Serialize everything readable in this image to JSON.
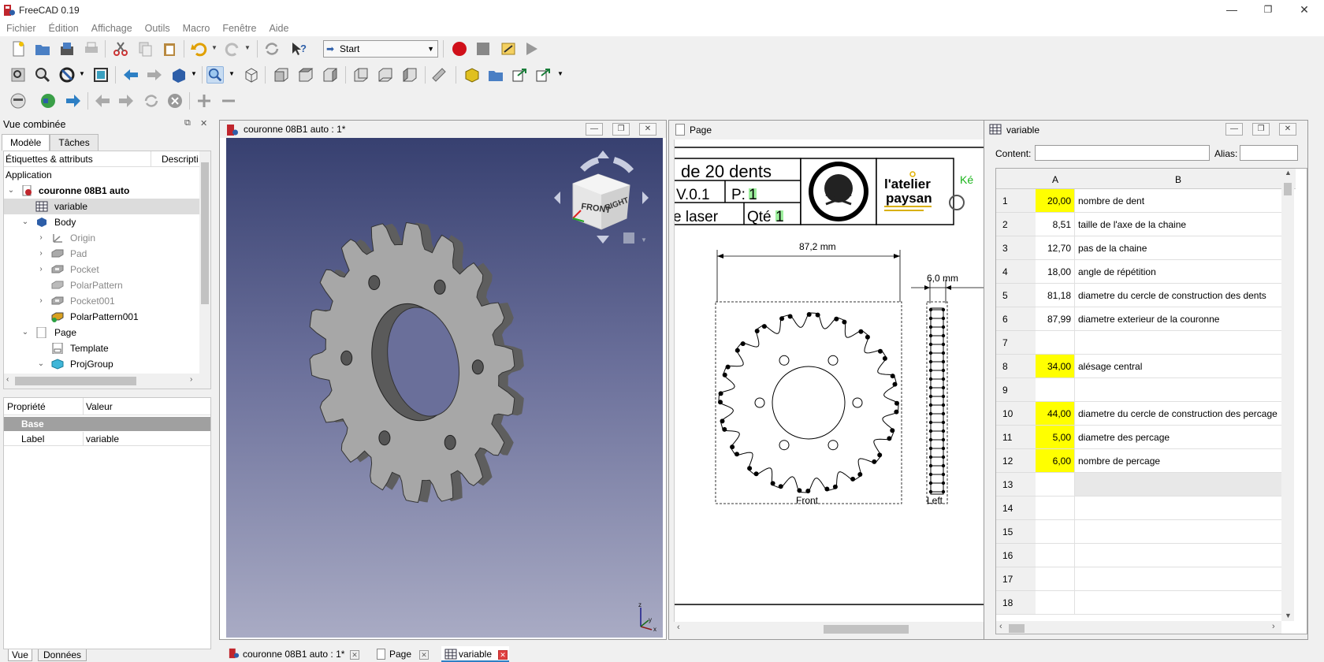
{
  "window": {
    "title": "FreeCAD 0.19",
    "min": "—",
    "max": "❐",
    "close": "✕"
  },
  "menu": [
    "Fichier",
    "Édition",
    "Affichage",
    "Outils",
    "Macro",
    "Fenêtre",
    "Aide"
  ],
  "toolbar": {
    "workbench": "Start"
  },
  "combo": {
    "title": "Vue combinée",
    "tabs": [
      "Modèle",
      "Tâches"
    ],
    "tree_headers": [
      "Étiquettes & attributs",
      "Descripti"
    ],
    "tree": [
      {
        "label": "Application"
      },
      {
        "label": "couronne 08B1 auto"
      },
      {
        "label": "variable"
      },
      {
        "label": "Body"
      },
      {
        "label": "Origin"
      },
      {
        "label": "Pad"
      },
      {
        "label": "Pocket"
      },
      {
        "label": "PolarPattern"
      },
      {
        "label": "Pocket001"
      },
      {
        "label": "PolarPattern001"
      },
      {
        "label": "Page"
      },
      {
        "label": "Template"
      },
      {
        "label": "ProjGroup"
      }
    ],
    "prop_headers": [
      "Propriété",
      "Valeur"
    ],
    "prop_group": "Base",
    "prop_label": "Label",
    "prop_value": "variable",
    "bottom_tabs": [
      "Vue",
      "Données"
    ]
  },
  "view3d": {
    "title": "couronne 08B1 auto : 1*",
    "cube_front": "FRONT",
    "cube_right": "RIGHT"
  },
  "page": {
    "title": "Page",
    "tb_title": "de 20 dents",
    "tb_version": "V.0.1",
    "tb_p": "P:",
    "tb_p_val": "1",
    "tb_laser": "e laser",
    "tb_qte": "Qté",
    "tb_qte_val": "1",
    "logo_top": "l'atelier",
    "logo_bottom": "paysan",
    "kev": "Ké",
    "dim1": "87,2  mm",
    "dim2": "6,0  mm",
    "front_label": "Front",
    "left_label": "Left"
  },
  "spreadsheet": {
    "title": "variable",
    "content_label": "Content:",
    "alias_label": "Alias:",
    "col_a": "A",
    "col_b": "B",
    "rows": [
      {
        "n": "1",
        "a": "20,00",
        "b": "nombre de dent",
        "hl": true
      },
      {
        "n": "2",
        "a": "8,51",
        "b": "taille de l'axe de la chaine",
        "hl": false
      },
      {
        "n": "3",
        "a": "12,70",
        "b": "pas de la chaine",
        "hl": false
      },
      {
        "n": "4",
        "a": "18,00",
        "b": "angle de répétition",
        "hl": false
      },
      {
        "n": "5",
        "a": "81,18",
        "b": "diametre du cercle de construction des dents",
        "hl": false
      },
      {
        "n": "6",
        "a": "87,99",
        "b": "diametre exterieur de la couronne",
        "hl": false
      },
      {
        "n": "7",
        "a": "",
        "b": "",
        "hl": false
      },
      {
        "n": "8",
        "a": "34,00",
        "b": "alésage central",
        "hl": true
      },
      {
        "n": "9",
        "a": "",
        "b": "",
        "hl": false
      },
      {
        "n": "10",
        "a": "44,00",
        "b": "diametre du cercle de construction des percage",
        "hl": true
      },
      {
        "n": "11",
        "a": "5,00",
        "b": "diametre des percage",
        "hl": true
      },
      {
        "n": "12",
        "a": "6,00",
        "b": "nombre de percage",
        "hl": true
      },
      {
        "n": "13",
        "a": "",
        "b": "",
        "hl": false
      },
      {
        "n": "14",
        "a": "",
        "b": "",
        "hl": false
      },
      {
        "n": "15",
        "a": "",
        "b": "",
        "hl": false
      },
      {
        "n": "16",
        "a": "",
        "b": "",
        "hl": false
      },
      {
        "n": "17",
        "a": "",
        "b": "",
        "hl": false
      },
      {
        "n": "18",
        "a": "",
        "b": "",
        "hl": false
      }
    ]
  },
  "bottom_tabs": [
    "couronne 08B1 auto : 1*",
    "Page",
    "variable"
  ]
}
